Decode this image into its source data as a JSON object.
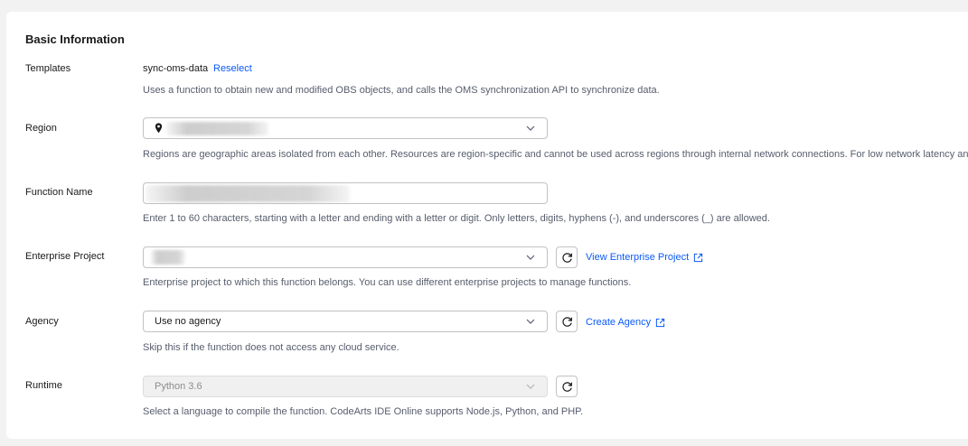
{
  "section": {
    "title": "Basic Information"
  },
  "templates": {
    "label": "Templates",
    "value": "sync-oms-data",
    "reselect_label": "Reselect",
    "hint": "Uses a function to obtain new and modified OBS objects, and calls the OMS synchronization API to synchronize data."
  },
  "region": {
    "label": "Region",
    "hint": "Regions are geographic areas isolated from each other. Resources are region-specific and cannot be used across regions through internal network connections. For low network latency and qu"
  },
  "function_name": {
    "label": "Function Name",
    "hint": "Enter 1 to 60 characters, starting with a letter and ending with a letter or digit. Only letters, digits, hyphens (-), and underscores (_) are allowed."
  },
  "enterprise_project": {
    "label": "Enterprise Project",
    "view_link": "View Enterprise Project",
    "hint": "Enterprise project to which this function belongs. You can use different enterprise projects to manage functions."
  },
  "agency": {
    "label": "Agency",
    "value": "Use no agency",
    "create_link": "Create Agency",
    "hint": "Skip this if the function does not access any cloud service."
  },
  "runtime": {
    "label": "Runtime",
    "value": "Python 3.6",
    "hint": "Select a language to compile the function. CodeArts IDE Online supports Node.js, Python, and PHP."
  },
  "colors": {
    "link": "#0a59f7",
    "hint": "#575d6c",
    "border": "#c2c2c2"
  }
}
